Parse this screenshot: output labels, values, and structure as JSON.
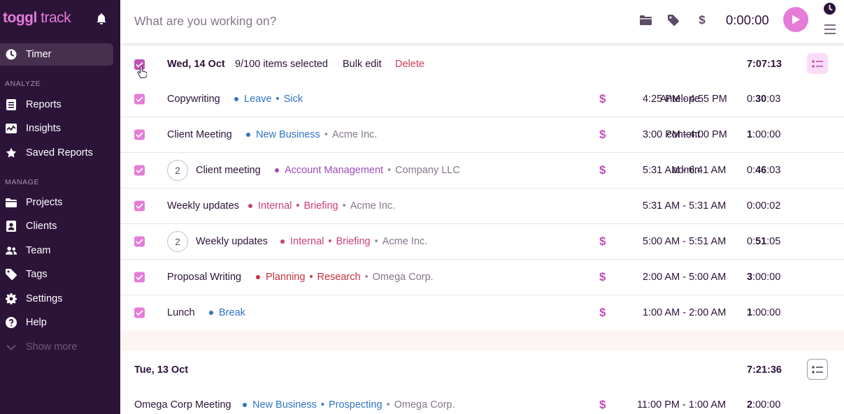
{
  "app": {
    "logo_bold": "toggl",
    "logo_light": " track"
  },
  "sidebar": {
    "timer_label": "Timer",
    "analyze_label": "ANALYZE",
    "manage_label": "MANAGE",
    "items": [
      {
        "label": "Reports",
        "icon": "reports-icon"
      },
      {
        "label": "Insights",
        "icon": "insights-icon"
      },
      {
        "label": "Saved Reports",
        "icon": "star-icon"
      },
      {
        "label": "Projects",
        "icon": "folder-icon"
      },
      {
        "label": "Clients",
        "icon": "clients-icon"
      },
      {
        "label": "Team",
        "icon": "team-icon"
      },
      {
        "label": "Tags",
        "icon": "tag-icon"
      },
      {
        "label": "Settings",
        "icon": "gear-icon"
      },
      {
        "label": "Help",
        "icon": "help-icon"
      }
    ],
    "show_more": "Show more"
  },
  "topbar": {
    "placeholder": "What are you working on?",
    "timer": "0:00:00"
  },
  "colors": {
    "accent": "#e57cd8",
    "sidebar_bg": "#2c1338",
    "delete": "#cf3c56"
  },
  "groups": [
    {
      "date": "Wed, 14 Oct",
      "selected": "9/100 items selected",
      "bulk_edit": "Bulk edit",
      "delete": "Delete",
      "total": "7:07:13",
      "entries": [
        {
          "desc": "Copywriting",
          "count": "",
          "project": "Leave",
          "task": "Sick",
          "client": "",
          "color": "#2f74c4",
          "tag": "Antelope",
          "billable": true,
          "range": "4:25 PM - 4:55 PM",
          "dur_a": "0:",
          "dur_b": "30",
          "dur_c": ":03"
        },
        {
          "desc": "Client Meeting",
          "count": "",
          "project": "New Business",
          "task": "",
          "client": "Acme Inc.",
          "color": "#2f74c4",
          "tag": "content",
          "billable": true,
          "range": "3:00 PM - 4:00 PM",
          "dur_a": "",
          "dur_b": "1",
          "dur_c": ":00:00"
        },
        {
          "desc": "Client meeting",
          "count": "2",
          "project": "Account Management",
          "task": "",
          "client": "Company LLC",
          "color": "#9a4cb8",
          "tag": "admin",
          "billable": true,
          "range": "5:31 AM - 6:41 AM",
          "dur_a": "0:",
          "dur_b": "46",
          "dur_c": ":03"
        },
        {
          "desc": "Weekly updates",
          "count": "",
          "project": "Internal",
          "task": "Briefing",
          "client": "Acme Inc.",
          "color": "#c73f7a",
          "tag": "",
          "billable": false,
          "range": "5:31 AM - 5:31 AM",
          "dur_a": "0:00:02",
          "dur_b": "",
          "dur_c": ""
        },
        {
          "desc": "Weekly updates",
          "count": "2",
          "project": "Internal",
          "task": "Briefing",
          "client": "Acme Inc.",
          "color": "#c73f7a",
          "tag": "",
          "billable": true,
          "range": "5:00 AM - 5:51 AM",
          "dur_a": "0:",
          "dur_b": "51",
          "dur_c": ":05"
        },
        {
          "desc": "Proposal Writing",
          "count": "",
          "project": "Planning",
          "task": "Research",
          "client": "Omega Corp.",
          "color": "#c4303c",
          "tag": "",
          "billable": true,
          "range": "2:00 AM - 5:00 AM",
          "dur_a": "",
          "dur_b": "3",
          "dur_c": ":00:00"
        },
        {
          "desc": "Lunch",
          "count": "",
          "project": "Break",
          "task": "",
          "client": "",
          "color": "#2f74c4",
          "tag": "",
          "billable": true,
          "range": "1:00 AM - 2:00 AM",
          "dur_a": "",
          "dur_b": "1",
          "dur_c": ":00:00"
        }
      ]
    },
    {
      "date": "Tue, 13 Oct",
      "total": "7:21:36",
      "entries": [
        {
          "desc": "Omega Corp Meeting",
          "count": "",
          "project": "New Business",
          "task": "Prospecting",
          "client": "Omega Corp.",
          "color": "#2f74c4",
          "tag": "",
          "billable": true,
          "range": "11:00 PM - 1:00 AM",
          "dur_a": "",
          "dur_b": "2",
          "dur_c": ":00:00"
        }
      ]
    }
  ]
}
